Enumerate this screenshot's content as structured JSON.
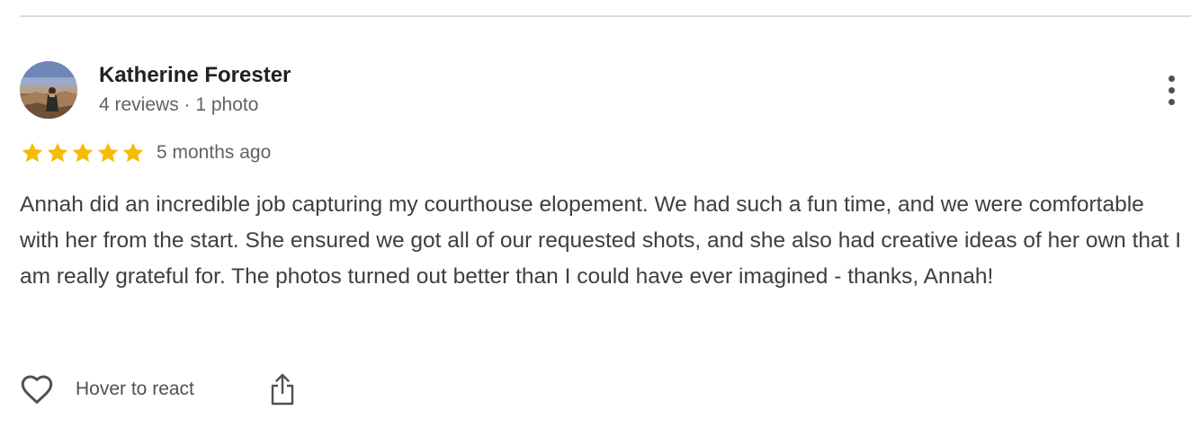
{
  "review": {
    "author_name": "Katherine Forester",
    "author_meta": "4 reviews · 1 photo",
    "rating": 5,
    "rating_max": 5,
    "time_ago": "5 months ago",
    "text": "Annah did an incredible job capturing my courthouse elopement. We had such a fun time, and we were comfortable with her from the start. She ensured we got all of our requested shots, and she also had creative ideas of her own that I am really grateful for. The photos turned out better than I could have ever imagined - thanks, Annah!",
    "actions": {
      "react_label": "Hover to react"
    }
  },
  "icons": {
    "avatar": "avatar-photo",
    "more": "more-vert-icon",
    "star": "star-icon",
    "heart": "heart-outline-icon",
    "share": "share-icon"
  },
  "colors": {
    "star": "#f6bb06",
    "text": "#3c4043",
    "secondary_text": "#5f6368",
    "divider": "#dadce0"
  }
}
